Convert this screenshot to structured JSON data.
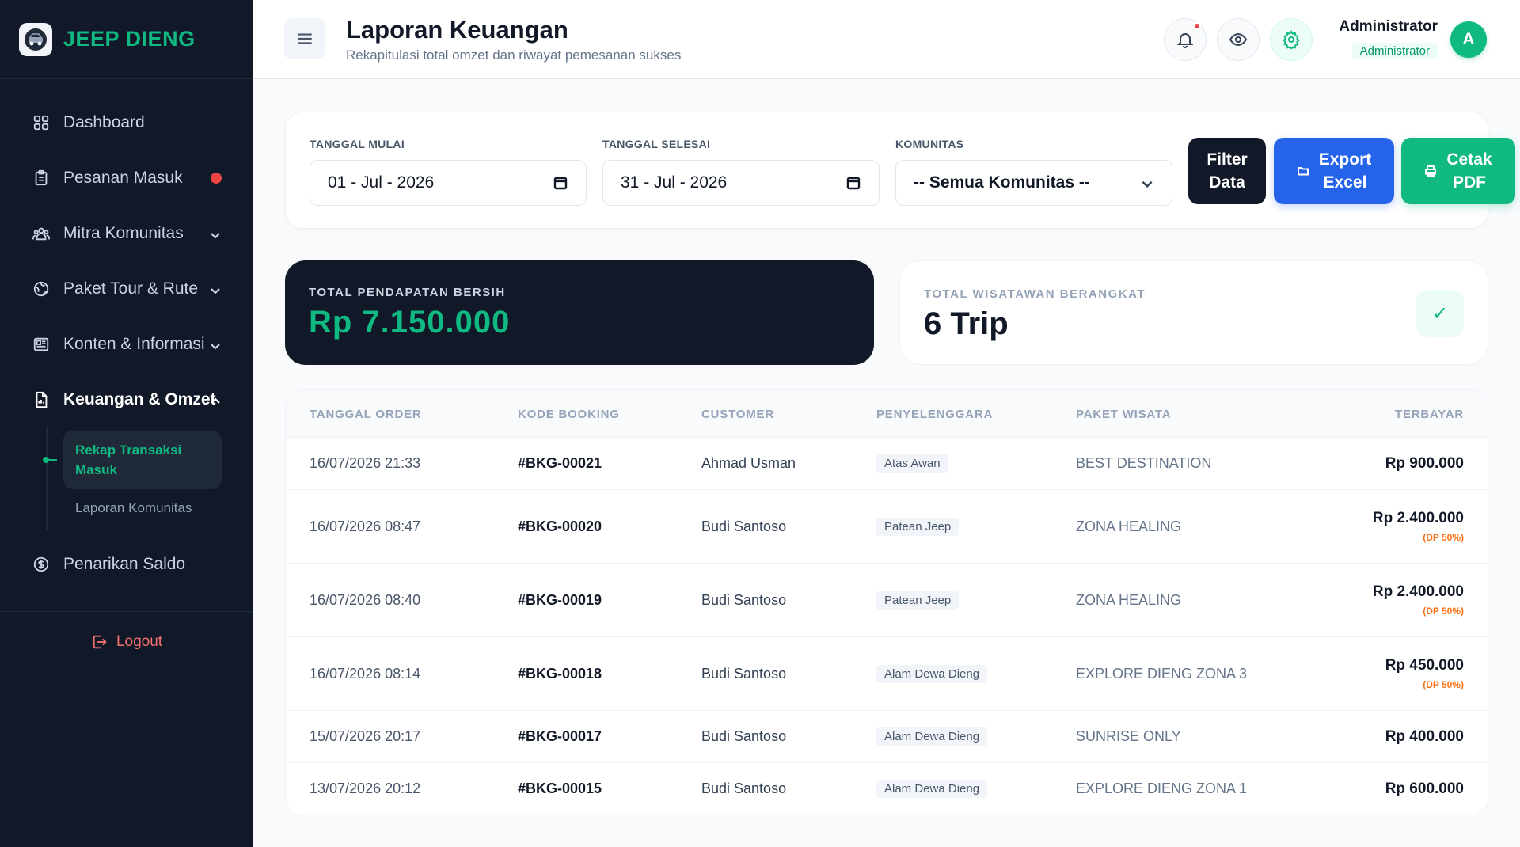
{
  "brand": {
    "name": "JEEP DIENG",
    "logo_text": "JEEP"
  },
  "sidebar": {
    "items": [
      {
        "label": "Dashboard",
        "icon": "grid-icon"
      },
      {
        "label": "Pesanan Masuk",
        "icon": "clipboard-icon",
        "badge": "red-dot"
      },
      {
        "label": "Mitra Komunitas",
        "icon": "users-icon"
      },
      {
        "label": "Paket Tour & Rute",
        "icon": "globe-icon"
      },
      {
        "label": "Konten & Informasi",
        "icon": "newspaper-icon"
      },
      {
        "label": "Keuangan & Omzet",
        "icon": "document-icon"
      },
      {
        "label": "Penarikan Saldo",
        "icon": "dollar-icon"
      }
    ],
    "subitems": [
      {
        "label": "Rekap Transaksi Masuk"
      },
      {
        "label": "Laporan Komunitas"
      }
    ],
    "logout": "Logout"
  },
  "header": {
    "title": "Laporan Keuangan",
    "subtitle": "Rekapitulasi total omzet dan riwayat pemesanan sukses",
    "user_name": "Administrator",
    "user_role": "Administrator",
    "avatar_initial": "A"
  },
  "filters": {
    "start_label": "TANGGAL MULAI",
    "start_value": "01 - Jul - 2026",
    "end_label": "TANGGAL SELESAI",
    "end_value": "31 - Jul - 2026",
    "community_label": "KOMUNITAS",
    "community_value": "-- Semua Komunitas --",
    "filter_btn_line1": "Filter",
    "filter_btn_line2": "Data",
    "excel_btn_line1": "Export",
    "excel_btn_line2": "Excel",
    "pdf_btn_line1": "Cetak",
    "pdf_btn_line2": "PDF"
  },
  "stats": {
    "revenue_label": "TOTAL PENDAPATAN BERSIH",
    "revenue_value": "Rp 7.150.000",
    "trips_label": "TOTAL WISATAWAN BERANGKAT",
    "trips_value": "6 Trip",
    "check": "✓"
  },
  "table": {
    "headers": [
      "TANGGAL ORDER",
      "KODE BOOKING",
      "CUSTOMER",
      "PENYELENGGARA",
      "PAKET WISATA",
      "TERBAYAR"
    ],
    "rows": [
      {
        "date": "16/07/2026 21:33",
        "code": "#BKG-00021",
        "customer": "Ahmad Usman",
        "organizer": "Atas Awan",
        "package": "BEST DESTINATION",
        "paid": "Rp 900.000",
        "note": ""
      },
      {
        "date": "16/07/2026 08:47",
        "code": "#BKG-00020",
        "customer": "Budi Santoso",
        "organizer": "Patean Jeep",
        "package": "ZONA HEALING",
        "paid": "Rp 2.400.000",
        "note": "(DP 50%)"
      },
      {
        "date": "16/07/2026 08:40",
        "code": "#BKG-00019",
        "customer": "Budi Santoso",
        "organizer": "Patean Jeep",
        "package": "ZONA HEALING",
        "paid": "Rp 2.400.000",
        "note": "(DP 50%)"
      },
      {
        "date": "16/07/2026 08:14",
        "code": "#BKG-00018",
        "customer": "Budi Santoso",
        "organizer": "Alam Dewa Dieng",
        "package": "EXPLORE DIENG ZONA 3",
        "paid": "Rp 450.000",
        "note": "(DP 50%)"
      },
      {
        "date": "15/07/2026 20:17",
        "code": "#BKG-00017",
        "customer": "Budi Santoso",
        "organizer": "Alam Dewa Dieng",
        "package": "SUNRISE ONLY",
        "paid": "Rp 400.000",
        "note": ""
      },
      {
        "date": "13/07/2026 20:12",
        "code": "#BKG-00015",
        "customer": "Budi Santoso",
        "organizer": "Alam Dewa Dieng",
        "package": "EXPLORE DIENG ZONA 1",
        "paid": "Rp 600.000",
        "note": ""
      }
    ]
  },
  "colors": {
    "accent": "#10b981",
    "sidebar_bg": "#111827",
    "blue": "#2563eb",
    "danger": "#ef4444",
    "warning": "#f97316"
  }
}
